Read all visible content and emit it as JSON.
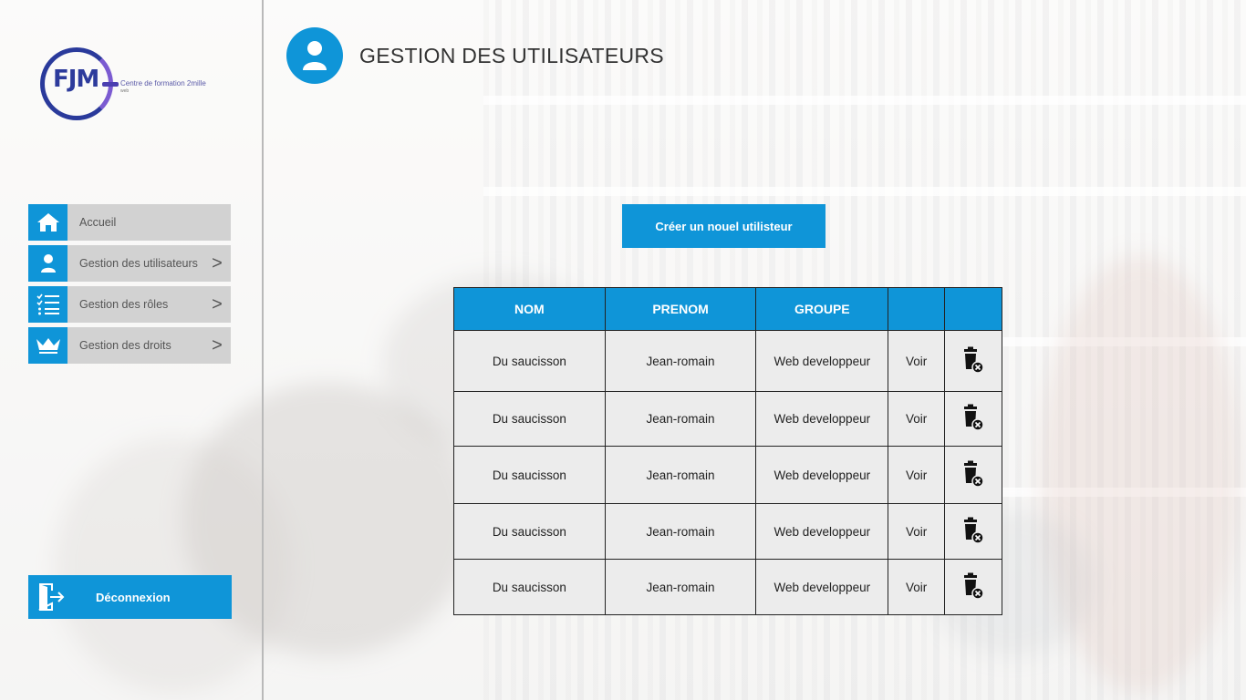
{
  "brand": {
    "logo_letters": "FJM",
    "tagline": "Centre de formation 2mille",
    "sub": "web"
  },
  "sidebar": {
    "items": [
      {
        "label": "Accueil",
        "icon": "home-icon",
        "chevron": ""
      },
      {
        "label": "Gestion des utilisateurs",
        "icon": "user-icon",
        "chevron": ">"
      },
      {
        "label": "Gestion des rôles",
        "icon": "checklist-icon",
        "chevron": ">"
      },
      {
        "label": "Gestion des droits",
        "icon": "crown-icon",
        "chevron": ">"
      }
    ],
    "logout_label": "Déconnexion"
  },
  "header": {
    "title": "GESTION DES UTILISATEURS",
    "icon": "user-icon"
  },
  "main": {
    "create_button_label": "Créer un nouel utilisteur",
    "table": {
      "columns": [
        "NOM",
        "PRENOM",
        "GROUPE",
        "",
        ""
      ],
      "rows": [
        {
          "nom": "Du saucisson",
          "prenom": "Jean-romain",
          "groupe": "Web developpeur",
          "action": "Voir"
        },
        {
          "nom": "Du saucisson",
          "prenom": "Jean-romain",
          "groupe": "Web developpeur",
          "action": "Voir"
        },
        {
          "nom": "Du saucisson",
          "prenom": "Jean-romain",
          "groupe": "Web developpeur",
          "action": "Voir"
        },
        {
          "nom": "Du saucisson",
          "prenom": "Jean-romain",
          "groupe": "Web developpeur",
          "action": "Voir"
        },
        {
          "nom": "Du saucisson",
          "prenom": "Jean-romain",
          "groupe": "Web developpeur",
          "action": "Voir"
        }
      ]
    }
  },
  "colors": {
    "accent": "#0f95d8",
    "nav_bg": "#d2d2d2",
    "cell_bg": "#ececec"
  }
}
